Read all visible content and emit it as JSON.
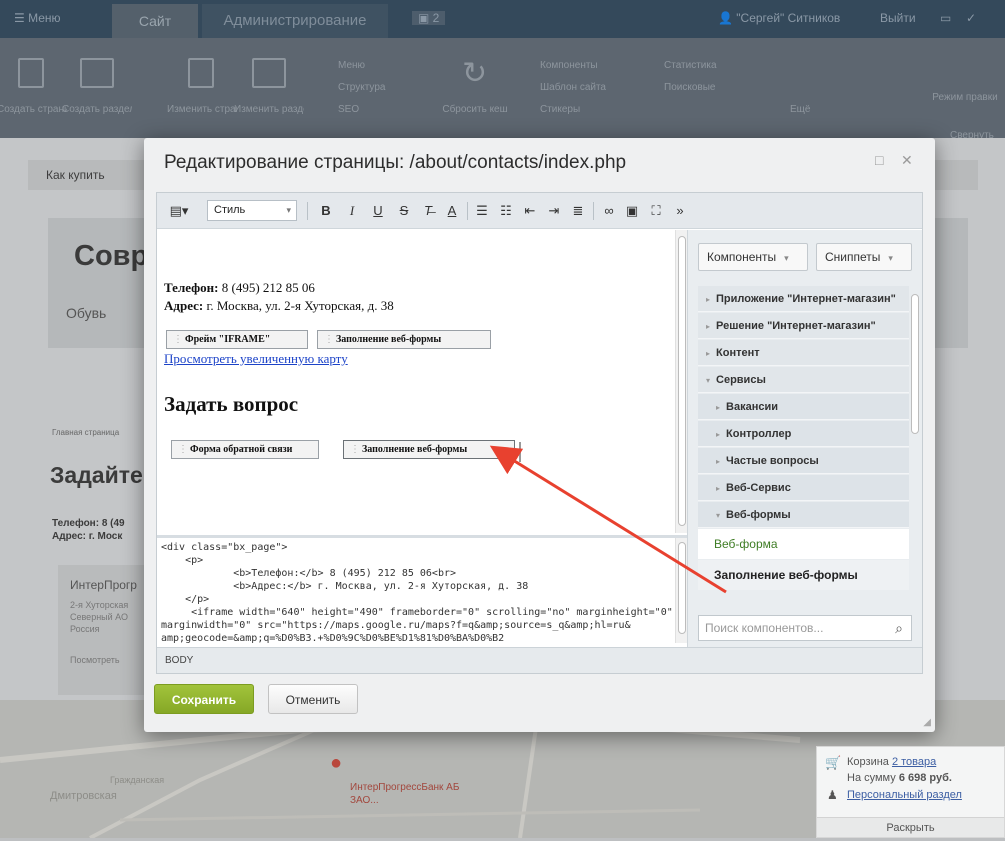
{
  "topbar": {
    "menu": "Меню",
    "tab_site": "Сайт",
    "tab_admin": "Администрирование",
    "notifications": "2",
    "user": "\"Сергей\" Ситников",
    "logout": "Выйти"
  },
  "ribbon": {
    "create_page": "Создать страницу",
    "create_section": "Создать раздел",
    "edit_page": "Изменить страницу",
    "edit_section": "Изменить раздел",
    "menu": "Меню",
    "structure": "Структура",
    "seo": "SEO",
    "reset_cache": "Сбросить кеш",
    "components": "Компоненты",
    "site_template": "Шаблон сайта",
    "stickers": "Стикеры",
    "statistics": "Статистика",
    "search_results": "Поисковые",
    "more": "Ещё",
    "edit_mode": "Режим правки",
    "collapse": "Свернуть"
  },
  "background": {
    "breadcrumb": "Как купить",
    "hero_title": "Совр",
    "hero_nav": "Обувь",
    "section_small": "Главная страница",
    "section_title": "Задайте",
    "phone_label": "Телефон: 8 (49",
    "address_label": "Адрес: г. Моск",
    "card_title": "ИнтерПрогр",
    "card_line1": "2-я Хуторская",
    "card_line2": "Северный АО",
    "card_line3": "Россия",
    "card_link": "Посмотреть",
    "map_label1": "ИнтерПрогрессБанк АБ",
    "map_label2": "ЗАО...",
    "map_label3": "Гражданская",
    "map_label4": "Дмитровская"
  },
  "modal": {
    "title": "Редактирование страницы: /about/contacts/index.php",
    "toolbar": {
      "style_select": "Стиль",
      "bold": "B",
      "italic": "I",
      "underline": "U",
      "strike": "S",
      "more": "»"
    },
    "content": {
      "phone_label": "Телефон:",
      "phone_value": " 8 (495) 212 85 06",
      "address_label": "Адрес:",
      "address_value": " г. Москва, ул. 2-я Хуторская, д. 38",
      "comp_iframe": "Фрейм \"IFRAME\"",
      "comp_webform1": "Заполнение веб-формы",
      "map_link": "Просмотреть увеличенную карту",
      "heading": "Задать вопрос",
      "comp_feedback": "Форма обратной связи",
      "comp_webform2": "Заполнение веб-формы"
    },
    "source": {
      "lines": [
        "<div class=\"bx_page\">",
        "    <p>",
        "            <b>Телефон:</b> 8 (495) 212 85 06<br>",
        "            <b>Адрес:</b> г. Москва, ул. 2-я Хуторская, д. 38",
        "    </p>",
        "     <iframe width=\"640\" height=\"490\" frameborder=\"0\" scrolling=\"no\" marginheight=\"0\"",
        "marginwidth=\"0\" src=\"https://maps.google.ru/maps?f=q&amp;source=s_q&amp;hl=ru&",
        "amp;geocode=&amp;q=%D0%B3.+%D0%9C%D0%BE%D1%81%D0%BA%D0%B2"
      ]
    },
    "status_path": "BODY",
    "panel": {
      "tab_components": "Компоненты",
      "tab_snippets": "Сниппеты",
      "tree": [
        "Приложение \"Интернет-магазин\"",
        "Решение \"Интернет-магазин\"",
        "Контент",
        "Сервисы",
        "Вакансии",
        "Контроллер",
        "Частые вопросы",
        "Веб-Сервис",
        "Веб-формы"
      ],
      "leaf_webform": "Веб-форма",
      "leaf_fill": "Заполнение веб-формы",
      "search_placeholder": "Поиск компонентов..."
    },
    "save": "Сохранить",
    "cancel": "Отменить"
  },
  "basket": {
    "label": "Корзина",
    "items": "2 товара",
    "sum_label": "На сумму",
    "sum": "6 698 руб.",
    "personal": "Персональный раздел",
    "expand": "Раскрыть"
  },
  "colors": {
    "accent_save": "#93b52e",
    "arrow": "#e8412f",
    "link": "#1c43c8"
  }
}
